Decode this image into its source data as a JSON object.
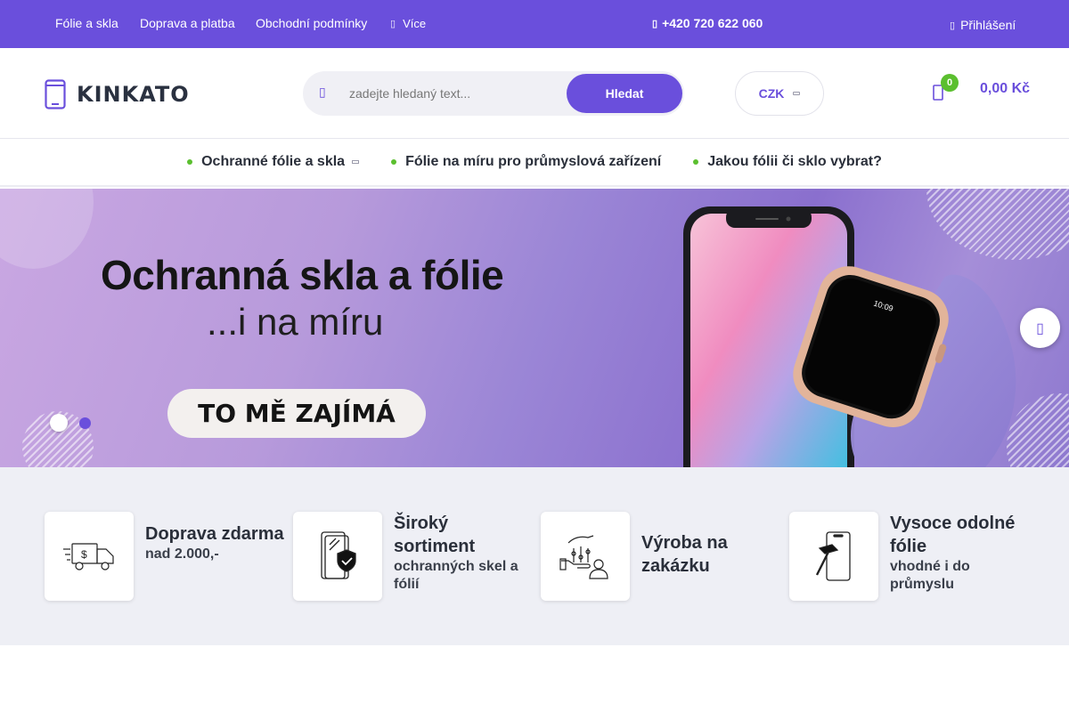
{
  "topbar": {
    "links": [
      "Fólie a skla",
      "Doprava a platba",
      "Obchodní podmínky"
    ],
    "more_label": "Více",
    "phone": "+420 720 622 060",
    "login_label": "Přihlášení"
  },
  "header": {
    "logo_text": "KINKATO",
    "search_placeholder": "zadejte hledaný text...",
    "search_button": "Hledat",
    "currency": "CZK",
    "cart_count": "0",
    "cart_total": "0,00 Kč"
  },
  "nav": {
    "items": [
      "Ochranné fólie a skla",
      "Fólie na míru pro průmyslová zařízení",
      "Jakou fólii či sklo vybrat?"
    ]
  },
  "banner": {
    "title": "Ochranná skla a fólie",
    "subtitle": "...i na míru",
    "cta": "TO MĚ ZAJÍMÁ",
    "watch_time": "10:09"
  },
  "benefits": [
    {
      "title": "Doprava zdarma",
      "subtitle": "nad 2.000,-",
      "icon": "delivery-truck-icon"
    },
    {
      "title": "Široký sortiment",
      "subtitle": "ochranných skel a fólií",
      "icon": "phone-shield-icon"
    },
    {
      "title": "Výroba na zakázku",
      "subtitle": "",
      "icon": "custom-production-icon"
    },
    {
      "title": "Vysoce odolné fólie",
      "subtitle": "vhodné i do průmyslu",
      "icon": "phone-hammer-icon"
    }
  ],
  "colors": {
    "brand": "#6a4fdc",
    "accent_green": "#5bbf2f"
  }
}
